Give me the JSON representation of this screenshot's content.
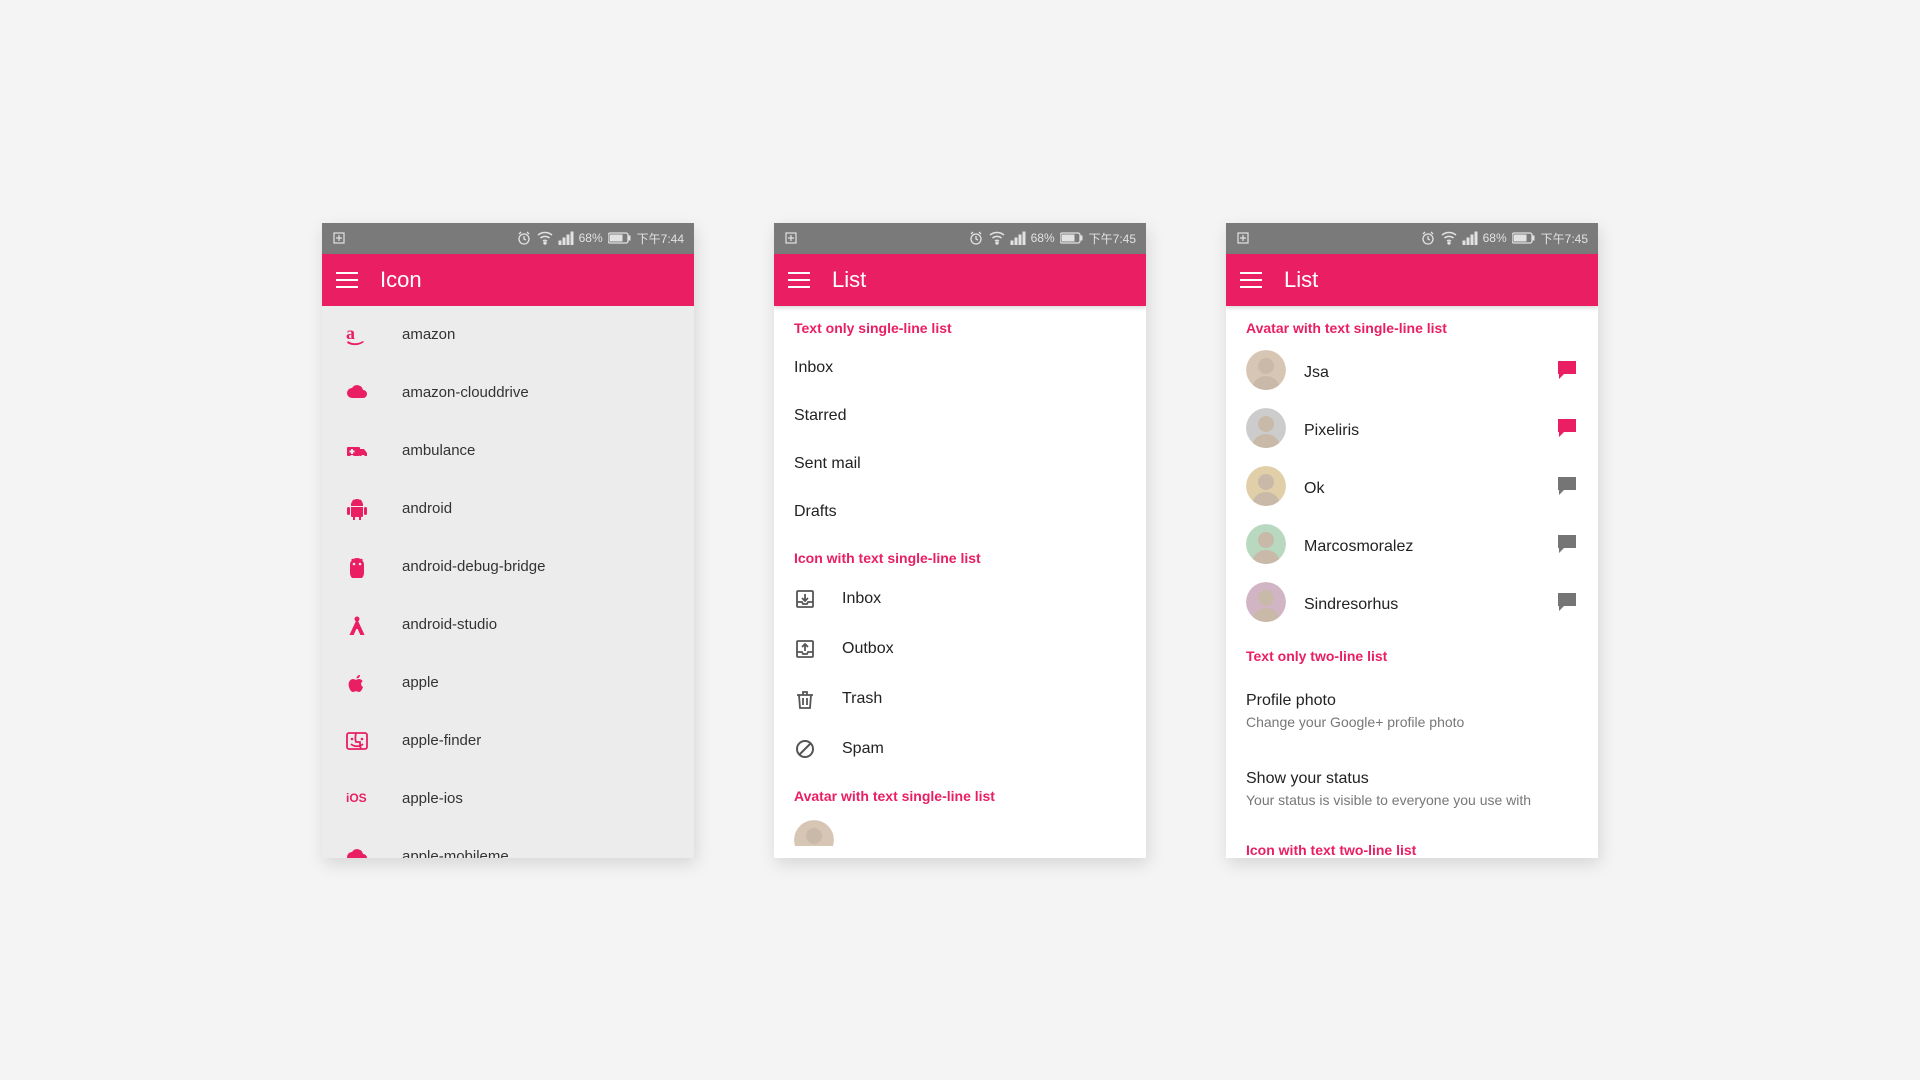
{
  "status": {
    "battery_text": "68%",
    "time1": "下午7:44",
    "time2": "下午7:45"
  },
  "screen1": {
    "title": "Icon",
    "items": [
      {
        "name": "amazon",
        "icon": "amazon"
      },
      {
        "name": "amazon-clouddrive",
        "icon": "cloud"
      },
      {
        "name": "ambulance",
        "icon": "ambulance"
      },
      {
        "name": "android",
        "icon": "android"
      },
      {
        "name": "android-debug-bridge",
        "icon": "adb"
      },
      {
        "name": "android-studio",
        "icon": "compass"
      },
      {
        "name": "apple",
        "icon": "apple"
      },
      {
        "name": "apple-finder",
        "icon": "finder"
      },
      {
        "name": "apple-ios",
        "icon": "ios"
      },
      {
        "name": "apple-mobileme",
        "icon": "cloud"
      }
    ]
  },
  "screen2": {
    "title": "List",
    "section_text": "Text only single-line list",
    "text_items": [
      "Inbox",
      "Starred",
      "Sent mail",
      "Drafts"
    ],
    "section_icon": "Icon with text single-line list",
    "icon_items": [
      {
        "label": "Inbox",
        "icon": "inbox-in"
      },
      {
        "label": "Outbox",
        "icon": "inbox-out"
      },
      {
        "label": "Trash",
        "icon": "trash"
      },
      {
        "label": "Spam",
        "icon": "block"
      }
    ],
    "section_avatar": "Avatar with text single-line list"
  },
  "screen3": {
    "title": "List",
    "section_avatar": "Avatar with text single-line list",
    "avatar_items": [
      {
        "label": "Jsa",
        "bubble": "pink",
        "avatar": "m1"
      },
      {
        "label": "Pixeliris",
        "bubble": "pink",
        "avatar": "f1"
      },
      {
        "label": "Ok",
        "bubble": "grey",
        "avatar": "m2"
      },
      {
        "label": "Marcosmoralez",
        "bubble": "grey",
        "avatar": "m3"
      },
      {
        "label": "Sindresorhus",
        "bubble": "grey",
        "avatar": "f2"
      }
    ],
    "section_text2": "Text only two-line list",
    "two_items": [
      {
        "pri": "Profile photo",
        "sec": "Change your Google+ profile photo"
      },
      {
        "pri": "Show your status",
        "sec": "Your status is visible to everyone you use with"
      }
    ],
    "section_icon2": "Icon with text two-line list"
  },
  "colors": {
    "pink": "#E91E63",
    "grey": "#757575"
  }
}
